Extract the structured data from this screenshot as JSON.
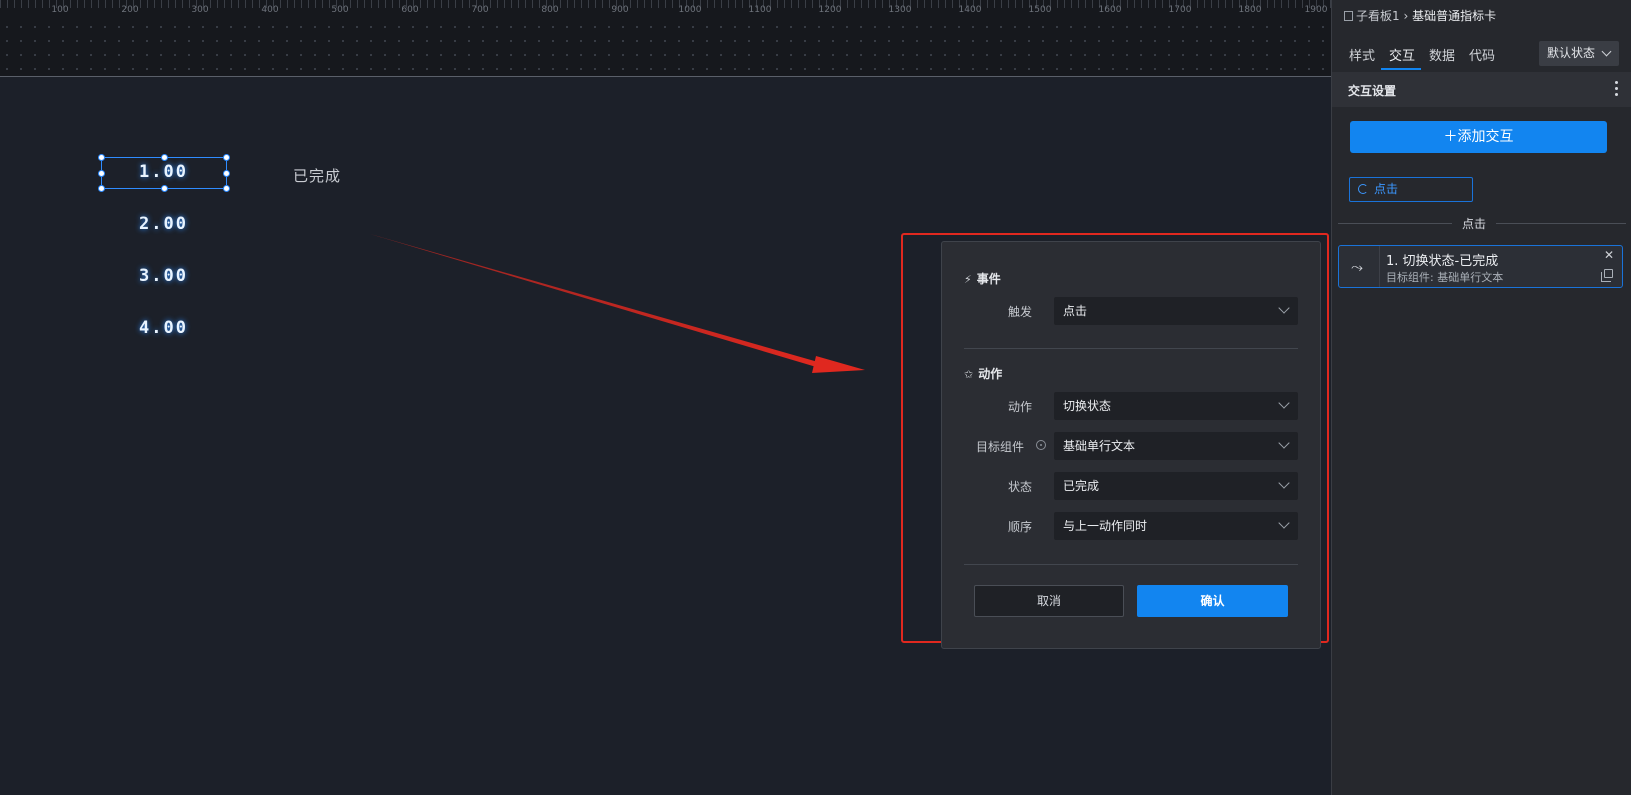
{
  "ruler": {
    "labels": [
      "100",
      "200",
      "300",
      "400",
      "500",
      "600",
      "700",
      "800",
      "900",
      "1000",
      "1100",
      "1200",
      "1300",
      "1400",
      "1500",
      "1600",
      "1700",
      "1800",
      "1900"
    ]
  },
  "canvas": {
    "numbers": [
      "1.00",
      "2.00",
      "3.00",
      "4.00"
    ],
    "status_text": "已完成"
  },
  "dialog": {
    "event": {
      "title": "事件",
      "trigger_label": "触发",
      "trigger_value": "点击"
    },
    "action": {
      "title": "动作",
      "action_label": "动作",
      "action_value": "切换状态",
      "target_label": "目标组件",
      "target_value": "基础单行文本",
      "state_label": "状态",
      "state_value": "已完成",
      "order_label": "顺序",
      "order_value": "与上一动作同时"
    },
    "cancel_label": "取消",
    "ok_label": "确认"
  },
  "panel": {
    "breadcrumb": {
      "parent": "子看板1",
      "separator": "›",
      "current": "基础普通指标卡"
    },
    "tabs": [
      "样式",
      "交互",
      "数据",
      "代码"
    ],
    "active_tab": "交互",
    "state_select": "默认状态",
    "section_title": "交互设置",
    "add_button": "添加交互",
    "trigger_tag": "点击",
    "group_label": "点击",
    "action_item": {
      "title": "1. 切换状态-已完成",
      "subtitle": "目标组件: 基础单行文本"
    }
  },
  "colors": {
    "accent": "#1285f0",
    "annotation": "#e0281f",
    "canvas_bg": "#1c2029",
    "panel_bg": "#26282d"
  }
}
